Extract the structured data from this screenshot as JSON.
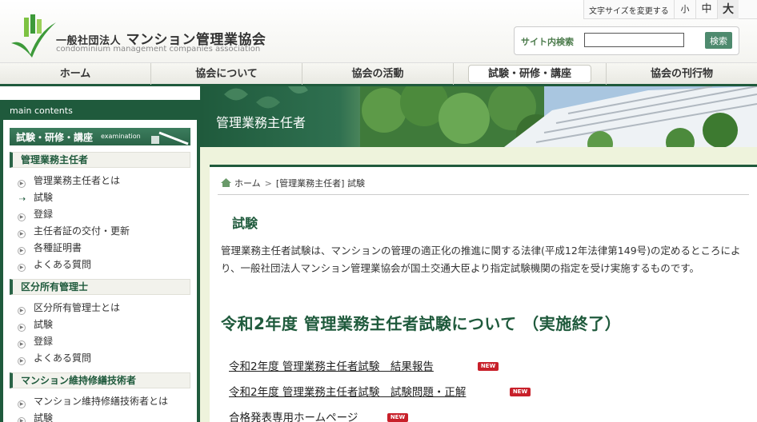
{
  "header": {
    "org_name_prefix": "一般社団法人",
    "org_name": "マンション管理業協会",
    "org_name_en": "condominium management companies association"
  },
  "font_size": {
    "label": "文字サイズを変更する",
    "small": "小",
    "medium": "中",
    "large": "大"
  },
  "search": {
    "label": "サイト内検索",
    "value": "",
    "button": "検索"
  },
  "nav": {
    "items": [
      {
        "label": "ホーム"
      },
      {
        "label": "協会について"
      },
      {
        "label": "協会の活動"
      },
      {
        "label": "試験・研修・講座",
        "active": true
      },
      {
        "label": "協会の刊行物"
      }
    ]
  },
  "sidebar": {
    "main_contents": "main contents",
    "section_title": "試験・研修・講座",
    "section_en": "examination",
    "groups": [
      {
        "title": "管理業務主任者",
        "links": [
          "管理業務主任者とは",
          "試験",
          "登録",
          "主任者証の交付・更新",
          "各種証明書",
          "よくある質問"
        ]
      },
      {
        "title": "区分所有管理士",
        "links": [
          "区分所有管理士とは",
          "試験",
          "登録",
          "よくある質問"
        ]
      },
      {
        "title": "マンション維持修繕技術者",
        "links": [
          "マンション維持修繕技術者とは",
          "試験"
        ]
      }
    ]
  },
  "banner": {
    "title": "管理業務主任者"
  },
  "breadcrumb": {
    "home": "ホーム",
    "separator": ">",
    "current": "[管理業務主任者] 試験"
  },
  "main": {
    "heading": "試験",
    "intro": "管理業務主任者試験は、マンションの管理の適正化の推進に関する法律(平成12年法律第149号)の定めるところにより、一般社団法人マンション管理業協会が国土交通大臣より指定試験機関の指定を受け実施するものです。",
    "big_heading": "令和2年度 管理業務主任者試験について （実施終了）",
    "links": [
      {
        "text": "令和2年度 管理業務主任者試験　結果報告",
        "badge": "NEW"
      },
      {
        "text": "令和2年度 管理業務主任者試験　試験問題・正解",
        "badge": "NEW"
      },
      {
        "text": "合格発表専用ホームページ",
        "badge": "NEW"
      }
    ]
  },
  "colors": {
    "brand_green": "#1f5a3c",
    "accent_green": "#4e8a6e",
    "badge_red": "#c8202a"
  }
}
